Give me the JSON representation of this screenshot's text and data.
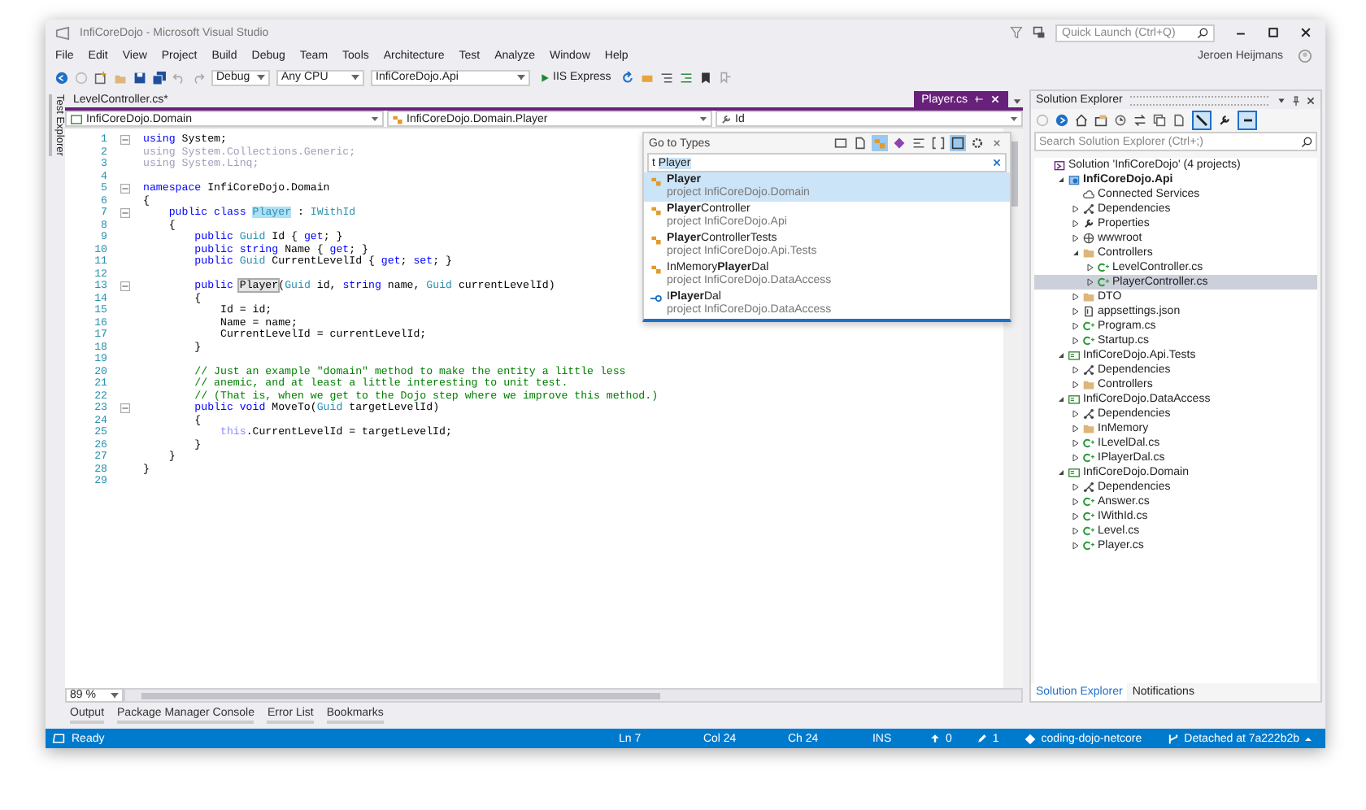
{
  "window": {
    "title": "InfiCoreDojo - Microsoft Visual Studio"
  },
  "quick_launch": {
    "placeholder": "Quick Launch (Ctrl+Q)"
  },
  "user": "Jeroen Heijmans",
  "menu": [
    "File",
    "Edit",
    "View",
    "Project",
    "Build",
    "Debug",
    "Team",
    "Tools",
    "Architecture",
    "Test",
    "Analyze",
    "Window",
    "Help"
  ],
  "toolbar": {
    "configuration": "Debug",
    "platform": "Any CPU",
    "startup_project": "InfiCoreDojo.Api",
    "run": "IIS Express"
  },
  "side_tab": "Test Explorer",
  "editor": {
    "tabs": [
      {
        "label": "LevelController.cs*",
        "selected": false
      },
      {
        "label": "Player.cs",
        "selected": true
      }
    ],
    "nav": [
      "InfiCoreDojo.Domain",
      "InfiCoreDojo.Domain.Player",
      "Id"
    ],
    "lines": [
      {
        "n": "1",
        "fold": true,
        "tokens": [
          {
            "t": "using ",
            "kind": "keyword"
          },
          {
            "t": "System;",
            "kind": "plain"
          }
        ]
      },
      {
        "n": "2",
        "fold": false,
        "tokens": [
          {
            "t": "using System.Collections.Generic;",
            "kind": "unused"
          }
        ]
      },
      {
        "n": "3",
        "fold": false,
        "tokens": [
          {
            "t": "using System.Linq;",
            "kind": "unused"
          }
        ]
      },
      {
        "n": "4",
        "fold": false
      },
      {
        "n": "5",
        "fold": true,
        "tokens": [
          {
            "t": "namespace ",
            "kind": "keyword"
          },
          {
            "t": "InfiCoreDojo.Domain",
            "kind": "plain"
          }
        ]
      },
      {
        "n": "6",
        "fold": false,
        "tokens": [
          {
            "t": "{",
            "kind": "plain"
          }
        ]
      },
      {
        "n": "7",
        "fold": true,
        "tokens": [
          {
            "t": "    public class ",
            "kind": "keyword"
          },
          {
            "t": "Player",
            "kind": "match"
          },
          {
            "t": " : ",
            "kind": "plain"
          },
          {
            "t": "IWithId",
            "kind": "type"
          }
        ]
      },
      {
        "n": "8",
        "fold": false,
        "tokens": [
          {
            "t": "    {",
            "kind": "plain"
          }
        ]
      },
      {
        "n": "9",
        "fold": false,
        "tokens": [
          {
            "t": "        public ",
            "kind": "keyword"
          },
          {
            "t": "Guid",
            "kind": "type"
          },
          {
            "t": " Id { ",
            "kind": "plain"
          },
          {
            "t": "get",
            "kind": "keyword"
          },
          {
            "t": "; }",
            "kind": "plain"
          }
        ]
      },
      {
        "n": "10",
        "fold": false,
        "tokens": [
          {
            "t": "        public string",
            "kind": "keyword"
          },
          {
            "t": " Name { ",
            "kind": "plain"
          },
          {
            "t": "get",
            "kind": "keyword"
          },
          {
            "t": "; }",
            "kind": "plain"
          }
        ]
      },
      {
        "n": "11",
        "fold": false,
        "tokens": [
          {
            "t": "        public ",
            "kind": "keyword"
          },
          {
            "t": "Guid",
            "kind": "type"
          },
          {
            "t": " CurrentLevelId { ",
            "kind": "plain"
          },
          {
            "t": "get",
            "kind": "keyword"
          },
          {
            "t": "; ",
            "kind": "plain"
          },
          {
            "t": "set",
            "kind": "keyword"
          },
          {
            "t": "; }",
            "kind": "plain"
          }
        ]
      },
      {
        "n": "12",
        "fold": false
      },
      {
        "n": "13",
        "fold": true,
        "tokens": [
          {
            "t": "        public ",
            "kind": "keyword"
          },
          {
            "t": "Player",
            "kind": "reference"
          },
          {
            "t": "(",
            "kind": "plain"
          },
          {
            "t": "Guid",
            "kind": "type"
          },
          {
            "t": " id, ",
            "kind": "plain"
          },
          {
            "t": "string",
            "kind": "keyword"
          },
          {
            "t": " name, ",
            "kind": "plain"
          },
          {
            "t": "Guid",
            "kind": "type"
          },
          {
            "t": " currentLevelId)",
            "kind": "plain"
          }
        ]
      },
      {
        "n": "14",
        "fold": false,
        "tokens": [
          {
            "t": "        {",
            "kind": "plain"
          }
        ]
      },
      {
        "n": "15",
        "fold": false,
        "tokens": [
          {
            "t": "            Id = id;",
            "kind": "plain"
          }
        ]
      },
      {
        "n": "16",
        "fold": false,
        "tokens": [
          {
            "t": "            Name = name;",
            "kind": "plain"
          }
        ]
      },
      {
        "n": "17",
        "fold": false,
        "tokens": [
          {
            "t": "            CurrentLevelId = currentLevelId;",
            "kind": "plain"
          }
        ]
      },
      {
        "n": "18",
        "fold": false,
        "tokens": [
          {
            "t": "        }",
            "kind": "plain"
          }
        ]
      },
      {
        "n": "19",
        "fold": false
      },
      {
        "n": "20",
        "fold": false,
        "tokens": [
          {
            "t": "        // Just an example \"domain\" method to make the entity a little less",
            "kind": "comment"
          }
        ]
      },
      {
        "n": "21",
        "fold": false,
        "tokens": [
          {
            "t": "        // anemic, and at least a little interesting to unit test.",
            "kind": "comment"
          }
        ]
      },
      {
        "n": "22",
        "fold": false,
        "tokens": [
          {
            "t": "        // (That is, when we get to the Dojo step where we improve this method.)",
            "kind": "comment"
          }
        ]
      },
      {
        "n": "23",
        "fold": true,
        "tokens": [
          {
            "t": "        public void",
            "kind": "keyword"
          },
          {
            "t": " MoveTo(",
            "kind": "plain"
          },
          {
            "t": "Guid",
            "kind": "type"
          },
          {
            "t": " targetLevelId)",
            "kind": "plain"
          }
        ]
      },
      {
        "n": "24",
        "fold": false,
        "tokens": [
          {
            "t": "        {",
            "kind": "plain"
          }
        ]
      },
      {
        "n": "25",
        "fold": false,
        "tokens": [
          {
            "t": "            this",
            "kind": "faded_keyword"
          },
          {
            "t": ".CurrentLevelId = targetLevelId;",
            "kind": "plain"
          }
        ]
      },
      {
        "n": "26",
        "fold": false,
        "tokens": [
          {
            "t": "        }",
            "kind": "plain"
          }
        ]
      },
      {
        "n": "27",
        "fold": false,
        "tokens": [
          {
            "t": "    }",
            "kind": "plain"
          }
        ]
      },
      {
        "n": "28",
        "fold": false,
        "tokens": [
          {
            "t": "}",
            "kind": "plain"
          }
        ]
      },
      {
        "n": "29",
        "fold": false
      }
    ],
    "zoom": "89 %"
  },
  "goto": {
    "title": "Go to Types",
    "prefix": "t",
    "query": "Player",
    "results": [
      {
        "name": "**Player**",
        "project": "project InfiCoreDojo.Domain",
        "kind": "class",
        "selected": true
      },
      {
        "name": "**Player**Controller",
        "project": "project InfiCoreDojo.Api",
        "kind": "class",
        "selected": false
      },
      {
        "name": "**Player**ControllerTests",
        "project": "project InfiCoreDojo.Api.Tests",
        "kind": "class",
        "selected": false
      },
      {
        "name": "InMemory**Player**Dal",
        "project": "project InfiCoreDojo.DataAccess",
        "kind": "class",
        "selected": false
      },
      {
        "name": "I**Player**Dal",
        "project": "project InfiCoreDojo.DataAccess",
        "kind": "interface",
        "selected": false
      }
    ]
  },
  "solution_explorer": {
    "title": "Solution Explorer",
    "search": {
      "placeholder": "Search Solution Explorer (Ctrl+;)"
    },
    "tree": [
      {
        "label": "Solution 'InfiCoreDojo' (4 projects)",
        "kind": "solution",
        "selected": false,
        "children": [
          {
            "label": "InfiCoreDojo.Api",
            "kind": "webproject",
            "startup": true,
            "expanded": true,
            "selected": false,
            "children": [
              {
                "label": "Connected Services",
                "kind": "cloud",
                "selected": false
              },
              {
                "label": "Dependencies",
                "kind": "deps",
                "expanded": false,
                "selected": false
              },
              {
                "label": "Properties",
                "kind": "wrench",
                "expanded": false,
                "selected": false
              },
              {
                "label": "wwwroot",
                "kind": "globe",
                "expanded": false,
                "selected": false
              },
              {
                "label": "Controllers",
                "kind": "folder",
                "expanded": true,
                "selected": false,
                "children": [
                  {
                    "label": "LevelController.cs",
                    "kind": "cs",
                    "expanded": false,
                    "selected": false
                  },
                  {
                    "label": "PlayerController.cs",
                    "kind": "cs",
                    "expanded": false,
                    "selected": true
                  }
                ]
              },
              {
                "label": "DTO",
                "kind": "folder",
                "expanded": false,
                "selected": false
              },
              {
                "label": "appsettings.json",
                "kind": "json",
                "expanded": false,
                "selected": false
              },
              {
                "label": "Program.cs",
                "kind": "cs",
                "expanded": false,
                "selected": false
              },
              {
                "label": "Startup.cs",
                "kind": "cs",
                "expanded": false,
                "selected": false
              }
            ]
          },
          {
            "label": "InfiCoreDojo.Api.Tests",
            "kind": "project",
            "startup": false,
            "expanded": true,
            "selected": false,
            "children": [
              {
                "label": "Dependencies",
                "kind": "deps",
                "expanded": false,
                "selected": false
              },
              {
                "label": "Controllers",
                "kind": "folder",
                "expanded": false,
                "selected": false
              }
            ]
          },
          {
            "label": "InfiCoreDojo.DataAccess",
            "kind": "project",
            "startup": false,
            "expanded": true,
            "selected": false,
            "children": [
              {
                "label": "Dependencies",
                "kind": "deps",
                "expanded": false,
                "selected": false
              },
              {
                "label": "InMemory",
                "kind": "folder",
                "expanded": false,
                "selected": false
              },
              {
                "label": "ILevelDal.cs",
                "kind": "cs",
                "expanded": false,
                "selected": false
              },
              {
                "label": "IPlayerDal.cs",
                "kind": "cs",
                "expanded": false,
                "selected": false
              }
            ]
          },
          {
            "label": "InfiCoreDojo.Domain",
            "kind": "project",
            "startup": false,
            "expanded": true,
            "selected": false,
            "children": [
              {
                "label": "Dependencies",
                "kind": "deps",
                "expanded": false,
                "selected": false
              },
              {
                "label": "Answer.cs",
                "kind": "cs",
                "expanded": false,
                "selected": false
              },
              {
                "label": "IWithId.cs",
                "kind": "cs",
                "expanded": false,
                "selected": false
              },
              {
                "label": "Level.cs",
                "kind": "cs",
                "expanded": false,
                "selected": false
              },
              {
                "label": "Player.cs",
                "kind": "cs",
                "expanded": false,
                "selected": false
              }
            ]
          }
        ]
      }
    ],
    "tabs": [
      {
        "label": "Solution Explorer",
        "selected": true
      },
      {
        "label": "Notifications",
        "selected": false
      }
    ]
  },
  "bottom_tabs": [
    "Output",
    "Package Manager Console",
    "Error List",
    "Bookmarks"
  ],
  "status_bar": {
    "message": "Ready",
    "line": "Ln 7",
    "col": "Col 24",
    "ch": "Ch 24",
    "mode": "INS",
    "pushes": "0",
    "changes": "1",
    "repo": "coding-dojo-netcore",
    "branch": "Detached at 7a222b2b"
  }
}
